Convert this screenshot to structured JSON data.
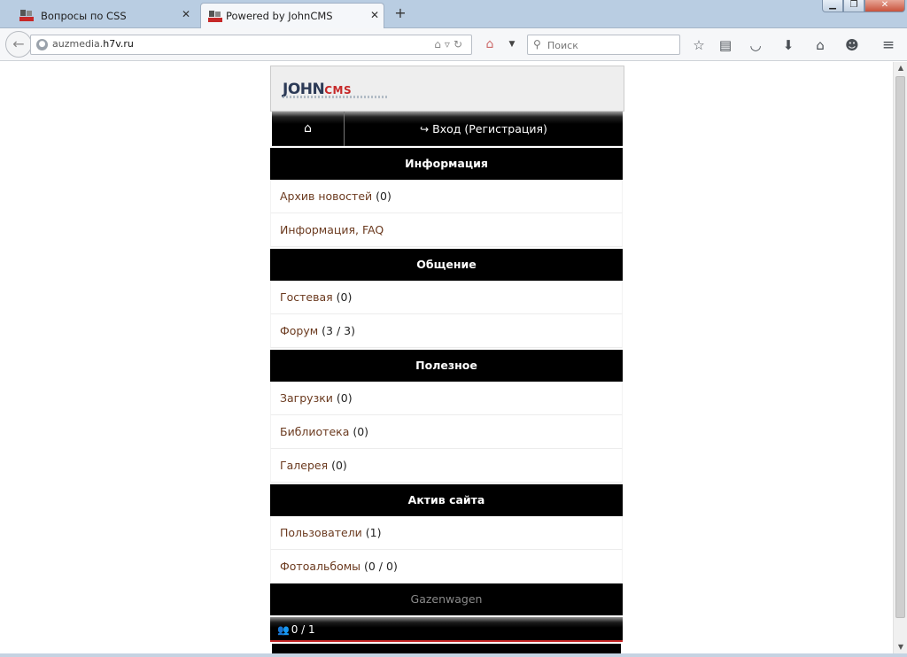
{
  "browser": {
    "tabs": [
      {
        "title": "Вопросы по CSS",
        "active": false
      },
      {
        "title": "Powered by JohnCMS",
        "active": true
      }
    ],
    "url_prefix": "auzmedia.",
    "url_domain": "h7v.ru",
    "search_placeholder": "Поиск"
  },
  "site": {
    "logo_main": "JOHN",
    "logo_sub": "CMS",
    "login_label": "Вход (Регистрация)"
  },
  "sections": [
    {
      "title": "Информация",
      "items": [
        {
          "label": "Архив новостей",
          "count": "(0)"
        },
        {
          "label": "Информация, FAQ",
          "count": ""
        }
      ]
    },
    {
      "title": "Общение",
      "items": [
        {
          "label": "Гостевая",
          "count": "(0)"
        },
        {
          "label": "Форум",
          "count": "(3 / 3)"
        }
      ]
    },
    {
      "title": "Полезное",
      "items": [
        {
          "label": "Загрузки",
          "count": "(0)"
        },
        {
          "label": "Библиотека",
          "count": "(0)"
        },
        {
          "label": "Галерея",
          "count": "(0)"
        }
      ]
    },
    {
      "title": "Актив сайта",
      "items": [
        {
          "label": "Пользователи",
          "count": "(1)"
        },
        {
          "label": "Фотоальбомы",
          "count": "(0 / 0)"
        }
      ]
    }
  ],
  "footer": {
    "site_name": "Gazenwagen",
    "online": "0 / 1"
  },
  "colors": {
    "link": "#6b3a1f",
    "section_bg": "#000000",
    "accent_line": "#c62828"
  }
}
